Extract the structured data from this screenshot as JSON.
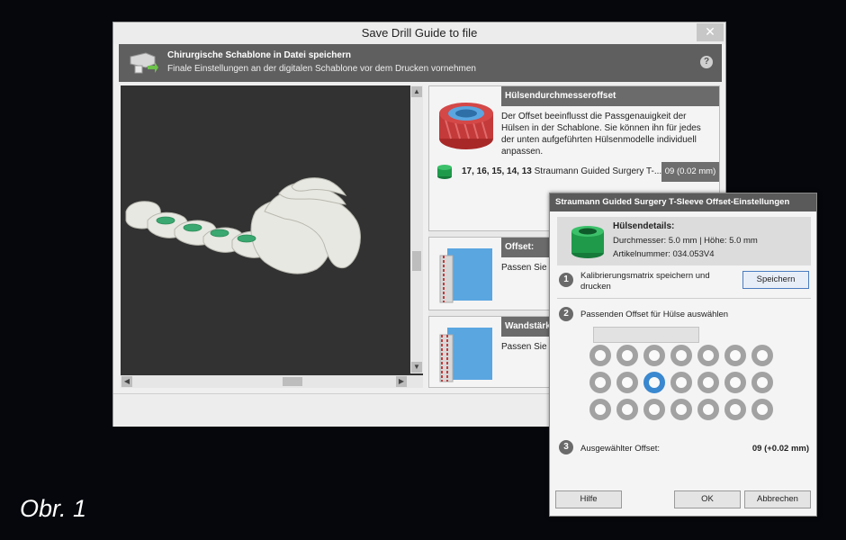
{
  "window": {
    "title": "Save Drill Guide to file",
    "close_glyph": "✕"
  },
  "header": {
    "title": "Chirurgische Schablone in Datei speichern",
    "subtitle": "Finale Einstellungen an der digitalen Schablone vor dem Drucken vornehmen",
    "help_glyph": "?"
  },
  "sections": {
    "sleeve_offset": {
      "title": "Hülsendurchmesseroffset",
      "text": "Der Offset beeinflusst die Passgenauigkeit der Hülsen in der Schablone. Sie können ihn für jedes der unten aufgeführten Hülsenmodelle individuell anpassen.",
      "row_teeth": "17, 16, 15, 14, 13",
      "row_model": "Straumann Guided Surgery T-...",
      "row_value": "09 (0.02 mm)"
    },
    "offset": {
      "title": "Offset:",
      "text": "Passen Sie d Schablone u festzulegen."
    },
    "wall": {
      "title": "Wandstärke",
      "text": "Passen Sie d Einfluss auf"
    }
  },
  "popup": {
    "title": "Straumann Guided Surgery T-Sleeve Offset-Einstellungen",
    "details_title": "Hülsendetails:",
    "details_dims": "Durchmesser: 5.0 mm | Höhe: 5.0 mm",
    "details_article": "Artikelnummer: 034.053V4",
    "step1_num": "1",
    "step1_text": "Kalibrierungsmatrix speichern und drucken",
    "save_label": "Speichern",
    "step2_num": "2",
    "step2_text": "Passenden Offset für Hülse auswählen",
    "step3_num": "3",
    "step3_text": "Ausgewählter Offset:",
    "step3_value": "09 (+0.02 mm)",
    "help_label": "Hilfe",
    "ok_label": "OK",
    "cancel_label": "Abbrechen",
    "ring_rows": 3,
    "ring_cols": 7,
    "selected_ring_row": 1,
    "selected_ring_col": 2
  },
  "caption": "Obr. 1",
  "colors": {
    "accent_blue": "#3a88cf",
    "sleeve_green": "#1f9a4a",
    "sleeve_red": "#c43a3a"
  }
}
